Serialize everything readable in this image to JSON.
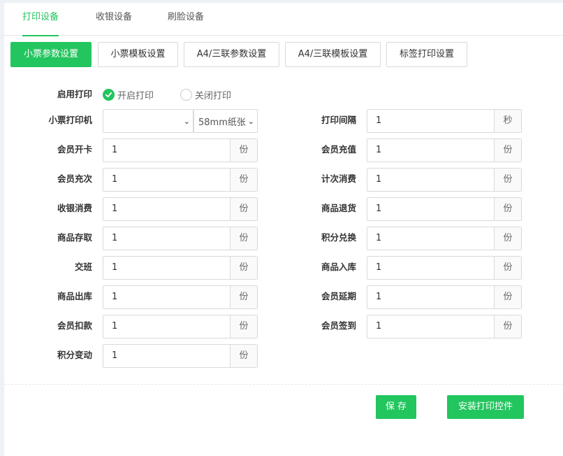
{
  "tabs": [
    "打印设备",
    "收银设备",
    "刷脸设备"
  ],
  "subtabs": [
    "小票参数设置",
    "小票模板设置",
    "A4/三联参数设置",
    "A4/三联模板设置",
    "标签打印设置"
  ],
  "enable": {
    "label": "启用打印",
    "on_label": "开启打印",
    "off_label": "关闭打印",
    "selected": "开启打印"
  },
  "printer": {
    "label": "小票打印机",
    "printer_value": "",
    "paper_value": "58mm纸张"
  },
  "interval": {
    "label": "打印间隔",
    "value": "1",
    "unit": "秒"
  },
  "left_fields": [
    {
      "label": "会员开卡",
      "value": "1",
      "unit": "份"
    },
    {
      "label": "会员充次",
      "value": "1",
      "unit": "份"
    },
    {
      "label": "收银消费",
      "value": "1",
      "unit": "份"
    },
    {
      "label": "商品存取",
      "value": "1",
      "unit": "份"
    },
    {
      "label": "交班",
      "value": "1",
      "unit": "份"
    },
    {
      "label": "商品出库",
      "value": "1",
      "unit": "份"
    },
    {
      "label": "会员扣款",
      "value": "1",
      "unit": "份"
    },
    {
      "label": "积分变动",
      "value": "1",
      "unit": "份"
    }
  ],
  "right_fields": [
    {
      "label": "会员充值",
      "value": "1",
      "unit": "份"
    },
    {
      "label": "计次消费",
      "value": "1",
      "unit": "份"
    },
    {
      "label": "商品退货",
      "value": "1",
      "unit": "份"
    },
    {
      "label": "积分兑换",
      "value": "1",
      "unit": "份"
    },
    {
      "label": "商品入库",
      "value": "1",
      "unit": "份"
    },
    {
      "label": "会员延期",
      "value": "1",
      "unit": "份"
    },
    {
      "label": "会员签到",
      "value": "1",
      "unit": "份"
    }
  ],
  "buttons": {
    "save": "保 存",
    "install": "安装打印控件"
  },
  "colors": {
    "accent": "#22c55e"
  }
}
